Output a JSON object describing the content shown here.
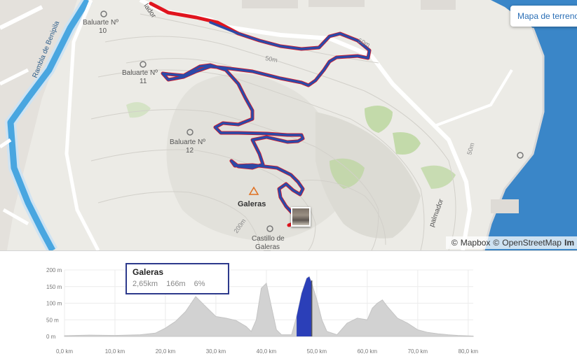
{
  "map": {
    "map_type_button": "Mapa de terreno",
    "attribution": {
      "copy1": "©",
      "mapbox": "Mapbox",
      "copy2": "©",
      "osm": "OpenStreetMap",
      "improve": "Im"
    },
    "labels": {
      "street_rambla": "Rambla de Benipila",
      "street_top": "lador",
      "street_right": "palmador",
      "baluarte10": [
        "Baluarte Nº",
        "10"
      ],
      "baluarte11": [
        "Baluarte Nº",
        "11"
      ],
      "baluarte12": [
        "Baluarte Nº",
        "12"
      ],
      "galeras": "Galeras",
      "castillo": [
        "Castillo de",
        "Galeras"
      ],
      "contour_50a": "50m",
      "contour_50b": "50m",
      "contour_50c": "50m",
      "contour_200": "200m"
    },
    "colors": {
      "route": "#2b4aa8",
      "route_outline": "#e0141e",
      "water": "#3a86c8",
      "canal": "#49a6e0",
      "vegetation": "#b9d69b"
    }
  },
  "profile": {
    "y_ticks": [
      "200 m",
      "150 m",
      "100 m",
      "50 m",
      "0 m"
    ],
    "x_ticks": [
      "0,0 km",
      "10,0 km",
      "20,0 km",
      "30,0 km",
      "40,0 km",
      "50,0 km",
      "60,0 km",
      "70,0 km",
      "80,0 km"
    ],
    "highlight_color": "#2b3fb8",
    "info": {
      "title": "Galeras",
      "distance": "2,65km",
      "elevation": "166m",
      "grade": "6%"
    }
  },
  "chart_data": {
    "type": "area",
    "title": "",
    "xlabel": "",
    "ylabel": "",
    "xlim": [
      0,
      81
    ],
    "ylim": [
      0,
      200
    ],
    "x": [
      0,
      5,
      10,
      15,
      18,
      20,
      22,
      24,
      26,
      28,
      30,
      32,
      34,
      36,
      37,
      38,
      39,
      40,
      41,
      42,
      43,
      45,
      46,
      47,
      48,
      48.5,
      49,
      50,
      51,
      52,
      54,
      56,
      58,
      60,
      61,
      62,
      63,
      64,
      66,
      68,
      70,
      72,
      74,
      76,
      78,
      81
    ],
    "series": [
      {
        "values": [
          2,
          4,
          3,
          5,
          10,
          25,
          45,
          75,
          120,
          90,
          60,
          55,
          48,
          30,
          15,
          50,
          145,
          160,
          90,
          20,
          5,
          5,
          60,
          130,
          175,
          180,
          160,
          110,
          50,
          15,
          5,
          40,
          55,
          50,
          85,
          100,
          110,
          90,
          55,
          40,
          20,
          12,
          8,
          5,
          3,
          1
        ]
      }
    ],
    "highlight_range_km": [
      46,
      49
    ]
  }
}
